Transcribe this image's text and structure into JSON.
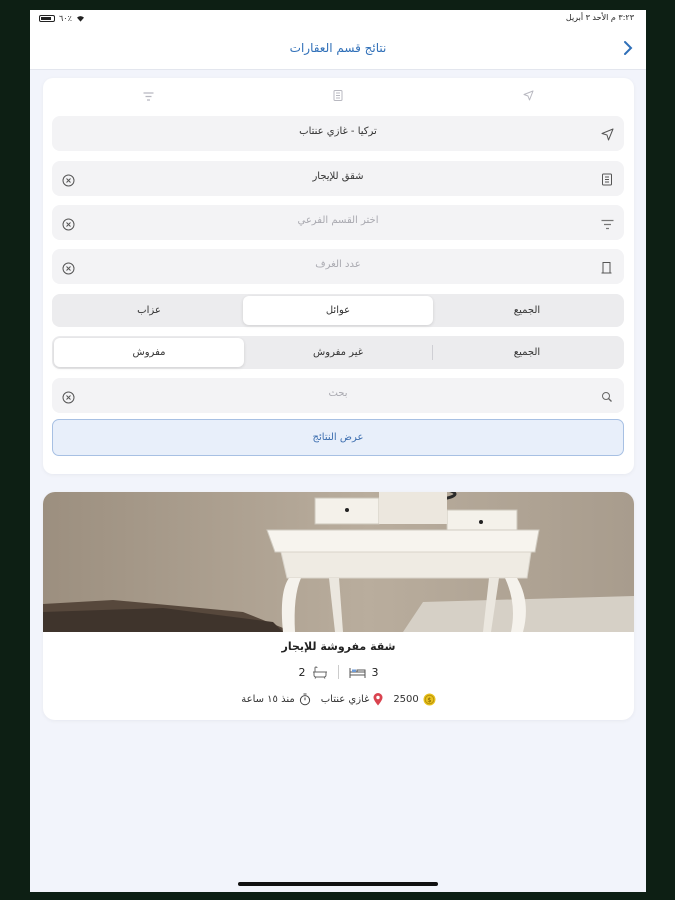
{
  "status": {
    "battery": "٦٠٪",
    "datetime": "٣:٢٣ م  الأحد ٣ أبريل"
  },
  "navbar": {
    "title": "نتائج قسم العقارات"
  },
  "filters": {
    "location": "تركيا - غازي عنتاب",
    "category": "شقق للإيجار",
    "subcategory_placeholder": "اختر القسم الفرعي",
    "rooms_placeholder": "عدد الغرف",
    "family_segment": [
      "الجميع",
      "عوائل",
      "عزاب"
    ],
    "family_selected": "عوائل",
    "furnish_segment": [
      "الجميع",
      "غير مفروش",
      "مفروش"
    ],
    "furnish_selected": "مفروش",
    "search_placeholder": "بحث",
    "show_results": "عرض النتائج"
  },
  "listing": {
    "title": "شقة مفروشة للإيجار",
    "bedrooms": "3",
    "bathrooms": "2",
    "price": "2500",
    "city": "غازي عنتاب",
    "time": "منذ ١٥ ساعة"
  },
  "colors": {
    "accent": "#2f6fb8",
    "location_pin": "#d9434f",
    "price_coin": "#e9c21e"
  },
  "icons": [
    "back-chevron-icon",
    "navigation-arrow-icon",
    "building-icon",
    "filter-icon",
    "door-icon",
    "clear-icon",
    "search-icon",
    "bed-icon",
    "bath-icon",
    "coin-icon",
    "location-pin-icon",
    "timer-icon"
  ]
}
